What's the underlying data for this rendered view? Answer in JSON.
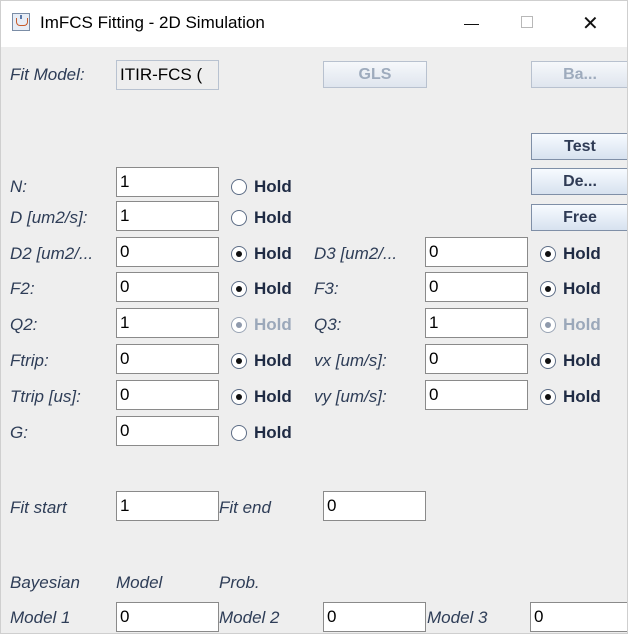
{
  "window": {
    "title": "ImFCS Fitting - 2D Simulation",
    "icon_name": "java-cup-icon",
    "controls": {
      "minimize": "—",
      "maximize": "☐",
      "close": "✕"
    }
  },
  "top": {
    "fit_model_label": "Fit Model:",
    "fit_model_value": "ITIR-FCS (",
    "gls_button": "GLS",
    "ba_button": "Ba...",
    "test_button": "Test",
    "de_button": "De...",
    "free_button": "Free"
  },
  "params_left": [
    {
      "label": "N:",
      "value": "1",
      "hold": "Hold",
      "checked": false,
      "disabled": false
    },
    {
      "label": "D [um2/s]:",
      "value": "1",
      "hold": "Hold",
      "checked": false,
      "disabled": false
    },
    {
      "label": "D2 [um2/...",
      "value": "0",
      "hold": "Hold",
      "checked": true,
      "disabled": false
    },
    {
      "label": "F2:",
      "value": "0",
      "hold": "Hold",
      "checked": true,
      "disabled": false
    },
    {
      "label": "Q2:",
      "value": "1",
      "hold": "Hold",
      "checked": true,
      "disabled": true
    },
    {
      "label": "Ftrip:",
      "value": "0",
      "hold": "Hold",
      "checked": true,
      "disabled": false
    },
    {
      "label": "Ttrip [us]:",
      "value": "0",
      "hold": "Hold",
      "checked": true,
      "disabled": false
    },
    {
      "label": "G:",
      "value": "0",
      "hold": "Hold",
      "checked": false,
      "disabled": false
    }
  ],
  "params_right": [
    {
      "label": "D3 [um2/...",
      "value": "0",
      "hold": "Hold",
      "checked": true,
      "disabled": false
    },
    {
      "label": "F3:",
      "value": "0",
      "hold": "Hold",
      "checked": true,
      "disabled": false
    },
    {
      "label": "Q3:",
      "value": "1",
      "hold": "Hold",
      "checked": true,
      "disabled": true
    },
    {
      "label": "vx [um/s]:",
      "value": "0",
      "hold": "Hold",
      "checked": true,
      "disabled": false
    },
    {
      "label": "vy [um/s]:",
      "value": "0",
      "hold": "Hold",
      "checked": true,
      "disabled": false
    }
  ],
  "fit_range": {
    "start_label": "Fit start",
    "start_value": "1",
    "end_label": "Fit end",
    "end_value": "0"
  },
  "bayesian": {
    "header": "Bayesian",
    "model_header": "Model",
    "prob_header": "Prob.",
    "model1_label": "Model 1",
    "model1_value": "0",
    "model2_label": "Model 2",
    "model2_value": "0",
    "model3_label": "Model 3",
    "model3_value": "0"
  }
}
